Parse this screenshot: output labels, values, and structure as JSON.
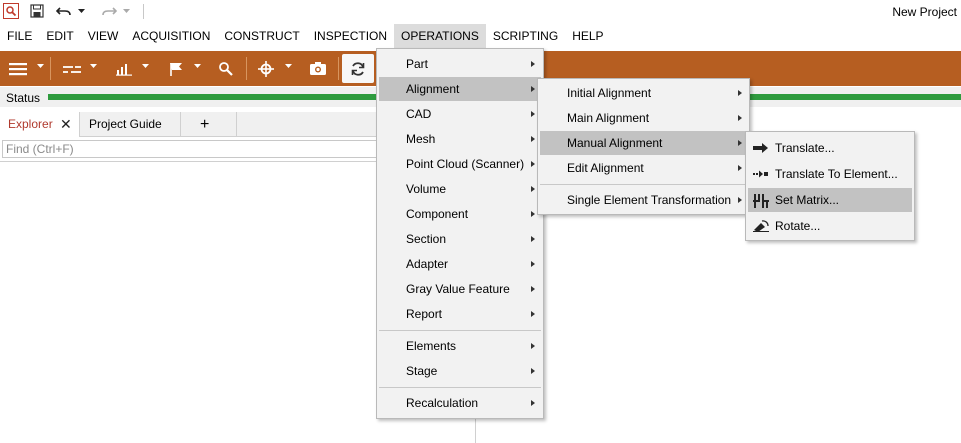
{
  "window": {
    "title": "New Project"
  },
  "menubar": [
    {
      "label": "FILE"
    },
    {
      "label": "EDIT"
    },
    {
      "label": "VIEW"
    },
    {
      "label": "ACQUISITION"
    },
    {
      "label": "CONSTRUCT"
    },
    {
      "label": "INSPECTION"
    },
    {
      "label": "OPERATIONS",
      "active": true
    },
    {
      "label": "SCRIPTING"
    },
    {
      "label": "HELP"
    }
  ],
  "status": {
    "label": "Status",
    "color": "#2e9b3e"
  },
  "toolbar": {
    "color": "#b65e21",
    "icons": [
      "hamburger-icon",
      "filter-icon",
      "chart-icon",
      "flag-icon",
      "search-icon",
      "crosshair-icon",
      "camera-icon",
      "refresh-icon"
    ]
  },
  "tabs": {
    "explorer": "Explorer",
    "close": "✕",
    "project_guide": "Project Guide",
    "add": "+"
  },
  "find": {
    "placeholder": "Find (Ctrl+F)"
  },
  "operations_menu": {
    "items": [
      "Part",
      "Alignment",
      "CAD",
      "Mesh",
      "Point Cloud (Scanner)",
      "Volume",
      "Component",
      "Section",
      "Adapter",
      "Gray Value Feature",
      "Report",
      "Elements",
      "Stage",
      "Recalculation"
    ],
    "highlighted": "Alignment"
  },
  "alignment_menu": {
    "items": [
      "Initial Alignment",
      "Main Alignment",
      "Manual Alignment",
      "Edit Alignment",
      "Single Element Transformation"
    ],
    "highlighted": "Manual Alignment"
  },
  "manual_alignment_menu": {
    "items": [
      {
        "label": "Translate...",
        "icon": "translate-arrow-icon"
      },
      {
        "label": "Translate To Element...",
        "icon": "translate-to-element-icon"
      },
      {
        "label": "Set Matrix...",
        "icon": "matrix-icon"
      },
      {
        "label": "Rotate...",
        "icon": "rotate-icon"
      }
    ],
    "highlighted": "Set Matrix..."
  }
}
